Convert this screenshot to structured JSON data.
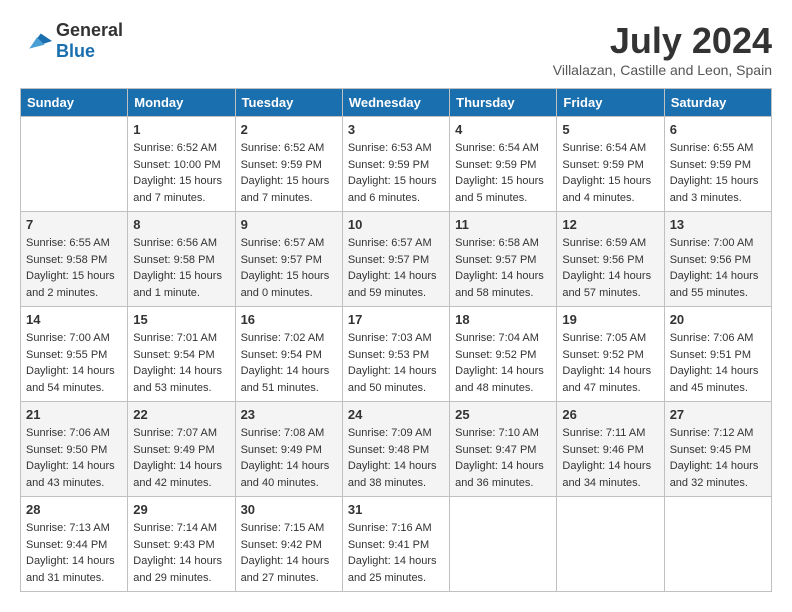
{
  "header": {
    "logo_general": "General",
    "logo_blue": "Blue",
    "month_title": "July 2024",
    "location": "Villalazan, Castille and Leon, Spain"
  },
  "days_of_week": [
    "Sunday",
    "Monday",
    "Tuesday",
    "Wednesday",
    "Thursday",
    "Friday",
    "Saturday"
  ],
  "weeks": [
    [
      {
        "day": "",
        "empty": true
      },
      {
        "day": "1",
        "sunrise": "6:52 AM",
        "sunset": "10:00 PM",
        "daylight": "15 hours and 7 minutes."
      },
      {
        "day": "2",
        "sunrise": "6:52 AM",
        "sunset": "9:59 PM",
        "daylight": "15 hours and 7 minutes."
      },
      {
        "day": "3",
        "sunrise": "6:53 AM",
        "sunset": "9:59 PM",
        "daylight": "15 hours and 6 minutes."
      },
      {
        "day": "4",
        "sunrise": "6:54 AM",
        "sunset": "9:59 PM",
        "daylight": "15 hours and 5 minutes."
      },
      {
        "day": "5",
        "sunrise": "6:54 AM",
        "sunset": "9:59 PM",
        "daylight": "15 hours and 4 minutes."
      },
      {
        "day": "6",
        "sunrise": "6:55 AM",
        "sunset": "9:59 PM",
        "daylight": "15 hours and 3 minutes."
      }
    ],
    [
      {
        "day": "7",
        "sunrise": "6:55 AM",
        "sunset": "9:58 PM",
        "daylight": "15 hours and 2 minutes."
      },
      {
        "day": "8",
        "sunrise": "6:56 AM",
        "sunset": "9:58 PM",
        "daylight": "15 hours and 1 minute."
      },
      {
        "day": "9",
        "sunrise": "6:57 AM",
        "sunset": "9:57 PM",
        "daylight": "15 hours and 0 minutes."
      },
      {
        "day": "10",
        "sunrise": "6:57 AM",
        "sunset": "9:57 PM",
        "daylight": "14 hours and 59 minutes."
      },
      {
        "day": "11",
        "sunrise": "6:58 AM",
        "sunset": "9:57 PM",
        "daylight": "14 hours and 58 minutes."
      },
      {
        "day": "12",
        "sunrise": "6:59 AM",
        "sunset": "9:56 PM",
        "daylight": "14 hours and 57 minutes."
      },
      {
        "day": "13",
        "sunrise": "7:00 AM",
        "sunset": "9:56 PM",
        "daylight": "14 hours and 55 minutes."
      }
    ],
    [
      {
        "day": "14",
        "sunrise": "7:00 AM",
        "sunset": "9:55 PM",
        "daylight": "14 hours and 54 minutes."
      },
      {
        "day": "15",
        "sunrise": "7:01 AM",
        "sunset": "9:54 PM",
        "daylight": "14 hours and 53 minutes."
      },
      {
        "day": "16",
        "sunrise": "7:02 AM",
        "sunset": "9:54 PM",
        "daylight": "14 hours and 51 minutes."
      },
      {
        "day": "17",
        "sunrise": "7:03 AM",
        "sunset": "9:53 PM",
        "daylight": "14 hours and 50 minutes."
      },
      {
        "day": "18",
        "sunrise": "7:04 AM",
        "sunset": "9:52 PM",
        "daylight": "14 hours and 48 minutes."
      },
      {
        "day": "19",
        "sunrise": "7:05 AM",
        "sunset": "9:52 PM",
        "daylight": "14 hours and 47 minutes."
      },
      {
        "day": "20",
        "sunrise": "7:06 AM",
        "sunset": "9:51 PM",
        "daylight": "14 hours and 45 minutes."
      }
    ],
    [
      {
        "day": "21",
        "sunrise": "7:06 AM",
        "sunset": "9:50 PM",
        "daylight": "14 hours and 43 minutes."
      },
      {
        "day": "22",
        "sunrise": "7:07 AM",
        "sunset": "9:49 PM",
        "daylight": "14 hours and 42 minutes."
      },
      {
        "day": "23",
        "sunrise": "7:08 AM",
        "sunset": "9:49 PM",
        "daylight": "14 hours and 40 minutes."
      },
      {
        "day": "24",
        "sunrise": "7:09 AM",
        "sunset": "9:48 PM",
        "daylight": "14 hours and 38 minutes."
      },
      {
        "day": "25",
        "sunrise": "7:10 AM",
        "sunset": "9:47 PM",
        "daylight": "14 hours and 36 minutes."
      },
      {
        "day": "26",
        "sunrise": "7:11 AM",
        "sunset": "9:46 PM",
        "daylight": "14 hours and 34 minutes."
      },
      {
        "day": "27",
        "sunrise": "7:12 AM",
        "sunset": "9:45 PM",
        "daylight": "14 hours and 32 minutes."
      }
    ],
    [
      {
        "day": "28",
        "sunrise": "7:13 AM",
        "sunset": "9:44 PM",
        "daylight": "14 hours and 31 minutes."
      },
      {
        "day": "29",
        "sunrise": "7:14 AM",
        "sunset": "9:43 PM",
        "daylight": "14 hours and 29 minutes."
      },
      {
        "day": "30",
        "sunrise": "7:15 AM",
        "sunset": "9:42 PM",
        "daylight": "14 hours and 27 minutes."
      },
      {
        "day": "31",
        "sunrise": "7:16 AM",
        "sunset": "9:41 PM",
        "daylight": "14 hours and 25 minutes."
      },
      {
        "day": "",
        "empty": true
      },
      {
        "day": "",
        "empty": true
      },
      {
        "day": "",
        "empty": true
      }
    ]
  ],
  "labels": {
    "sunrise": "Sunrise:",
    "sunset": "Sunset:",
    "daylight": "Daylight:"
  }
}
